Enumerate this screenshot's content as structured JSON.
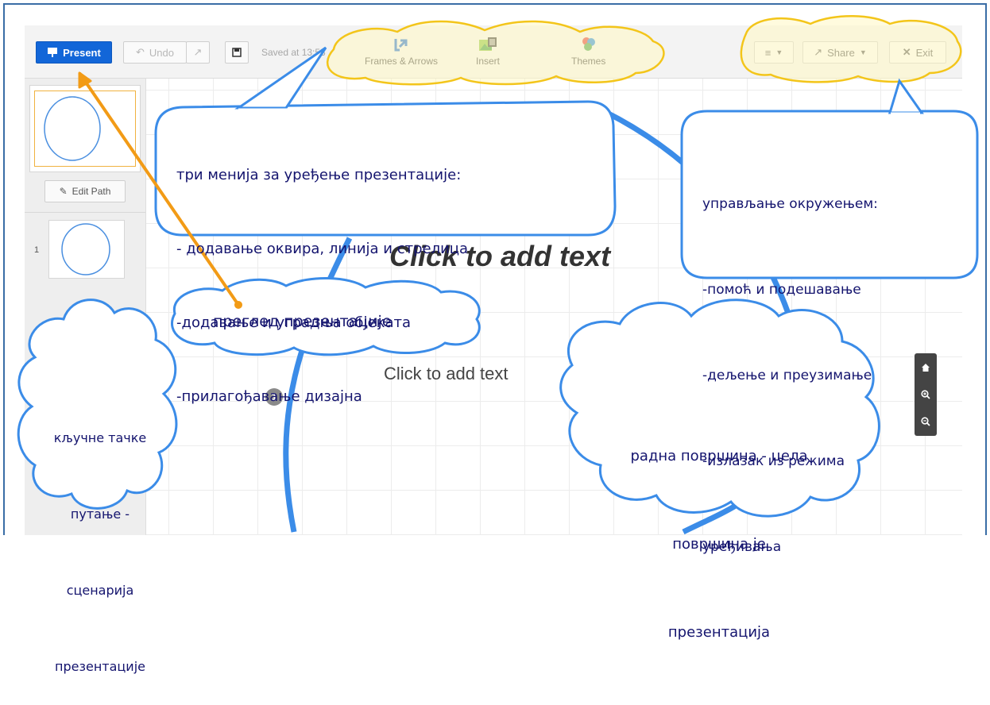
{
  "toolbar": {
    "present_label": "Present",
    "undo_label": "Undo",
    "saved_text": "Saved at 13:53",
    "frames_label": "Frames & Arrows",
    "insert_label": "Insert",
    "themes_label": "Themes",
    "share_label": "Share",
    "exit_label": "Exit"
  },
  "sidebar": {
    "edit_path_label": "Edit Path",
    "step_number": "1"
  },
  "canvas": {
    "title_placeholder": "Click to add text",
    "body_placeholder": "Click to add text",
    "path_marker": "1"
  },
  "annotations": {
    "menus_title": "три менија за уређење презентације:",
    "menus_line1": "- додавање оквира, линија и стрелица",
    "menus_line2": "-додавање и уградња објеката",
    "menus_line3": "-прилагођавање дизајна",
    "env_title": "управљање окружењем:",
    "env_line1": "-помоћ и подешавање",
    "env_line2": "-дељење и преузимање",
    "env_line3": "-излазак из режима",
    "env_line4": "уређивања",
    "preview": "преглед презентације",
    "keypoints_line1": "кључне тачке",
    "keypoints_line2": "путање -",
    "keypoints_line3": "сценарија",
    "keypoints_line4": "презентације",
    "workspace_line1": "радна површина - цела",
    "workspace_line2": "површина је",
    "workspace_line3": "презентација"
  },
  "colors": {
    "present_button": "#1266d8",
    "annotation_outline": "#3b8ce8",
    "cloud_fill": "#fff7c2",
    "cloud_outline": "#f3c51a",
    "arrow": "#f29b16",
    "annotation_text": "#14146e",
    "frame_border": "#3a6da6"
  },
  "icons": {
    "present": "projector-icon",
    "undo": "undo-arrow-icon",
    "redo": "redo-arrow-icon",
    "save": "floppy-disk-icon",
    "frames": "frame-arrow-icon",
    "insert": "image-film-icon",
    "themes": "color-circles-icon",
    "menu": "hamburger-icon",
    "share": "share-icon",
    "exit": "close-x-icon",
    "edit_path": "pencil-icon",
    "zoom_home": "home-icon",
    "zoom_in": "zoom-in-icon",
    "zoom_out": "zoom-out-icon"
  }
}
